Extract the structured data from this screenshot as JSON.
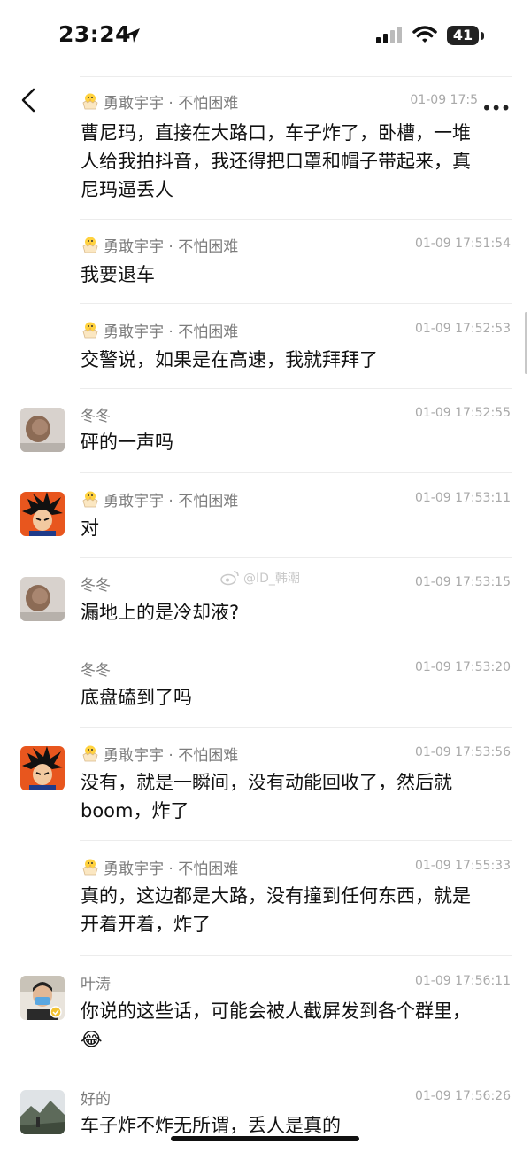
{
  "status_bar": {
    "time": "23:24",
    "battery": "41"
  },
  "watermark": "@ID_韩潮",
  "messages": [
    {
      "name": "勇敢宇宇 · 不怕困难",
      "time": "01-09 17:5",
      "text": [
        "曹尼玛，直接在大路口，车子炸了，卧槽，一堆",
        "人给我拍抖音，我还得把口罩和帽子带起来，真",
        "尼玛逼丢人"
      ]
    },
    {
      "name": "勇敢宇宇 · 不怕困难",
      "time": "01-09 17:51:54",
      "text": [
        "我要退车"
      ]
    },
    {
      "name": "勇敢宇宇 · 不怕困难",
      "time": "01-09 17:52:53",
      "text": [
        "交警说，如果是在高速，我就拜拜了"
      ]
    },
    {
      "name": "冬冬",
      "time": "01-09 17:52:55",
      "text": [
        "砰的一声吗"
      ]
    },
    {
      "name": "勇敢宇宇 · 不怕困难",
      "time": "01-09 17:53:11",
      "text": [
        "对"
      ]
    },
    {
      "name": "冬冬",
      "time": "01-09 17:53:15",
      "text": [
        "漏地上的是冷却液?"
      ]
    },
    {
      "name": "冬冬",
      "time": "01-09 17:53:20",
      "text": [
        "底盘磕到了吗"
      ]
    },
    {
      "name": "勇敢宇宇 · 不怕困难",
      "time": "01-09 17:53:56",
      "text": [
        "没有，就是一瞬间，没有动能回收了，然后就",
        "boom，炸了"
      ]
    },
    {
      "name": "勇敢宇宇 · 不怕困难",
      "time": "01-09 17:55:33",
      "text": [
        "真的，这边都是大路，没有撞到任何东西，就是",
        "开着开着，炸了"
      ]
    },
    {
      "name": "叶涛",
      "time": "01-09 17:56:11",
      "text": [
        "你说的这些话，可能会被人截屏发到各个群里，",
        "😂"
      ]
    },
    {
      "name": "好的",
      "time": "01-09 17:56:26",
      "text": [
        "车子炸不炸无所谓，丢人是真的"
      ]
    }
  ]
}
